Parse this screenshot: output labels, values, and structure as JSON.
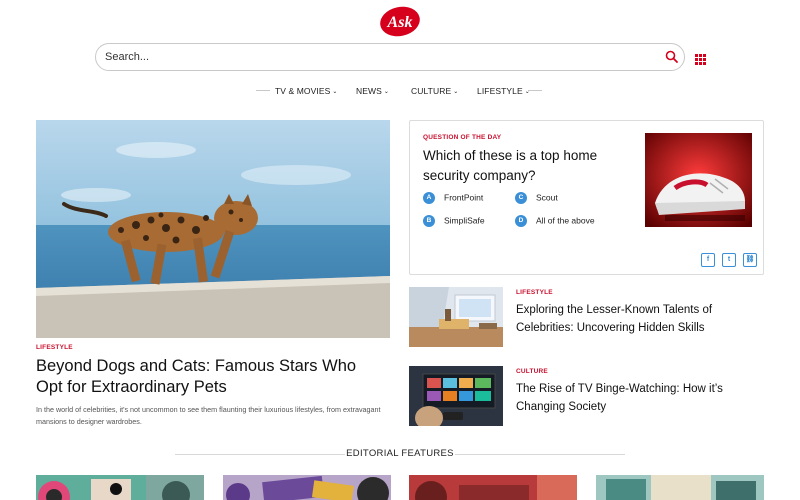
{
  "brand": {
    "logo_text": "Ask",
    "color": "#d6001c"
  },
  "search": {
    "placeholder": "Search..."
  },
  "nav": {
    "items": [
      {
        "label": "TV & MOVIES"
      },
      {
        "label": "NEWS"
      },
      {
        "label": "CULTURE"
      },
      {
        "label": "LIFESTYLE"
      }
    ]
  },
  "hero": {
    "category": "LIFESTYLE",
    "title": "Beyond Dogs and Cats: Famous Stars Who Opt for Extraordinary Pets",
    "description": "In the world of celebrities, it's not uncommon to see them flaunting their luxurious lifestyles, from extravagant mansions to designer wardrobes."
  },
  "question_of_the_day": {
    "label": "QUESTION OF THE DAY",
    "question": "Which of these is a top home security company?",
    "answers": [
      {
        "letter": "A",
        "text": "FrontPoint"
      },
      {
        "letter": "B",
        "text": "SimpliSafe"
      },
      {
        "letter": "C",
        "text": "Scout"
      },
      {
        "letter": "D",
        "text": "All of the above"
      }
    ],
    "share": [
      {
        "icon": "facebook-icon",
        "glyph": "f"
      },
      {
        "icon": "twitter-icon",
        "glyph": "t"
      },
      {
        "icon": "link-icon",
        "glyph": "⛓"
      }
    ]
  },
  "side_articles": [
    {
      "category": "LIFESTYLE",
      "title": "Exploring the Lesser-Known Talents of Celebrities: Uncovering Hidden Skills"
    },
    {
      "category": "CULTURE",
      "title": "The Rise of TV Binge-Watching: How it’s Changing Society"
    }
  ],
  "editorial": {
    "label": "EDITORIAL FEATURES"
  },
  "colors": {
    "accent_red": "#c8102e",
    "answer_blue": "#3a8fd6"
  }
}
